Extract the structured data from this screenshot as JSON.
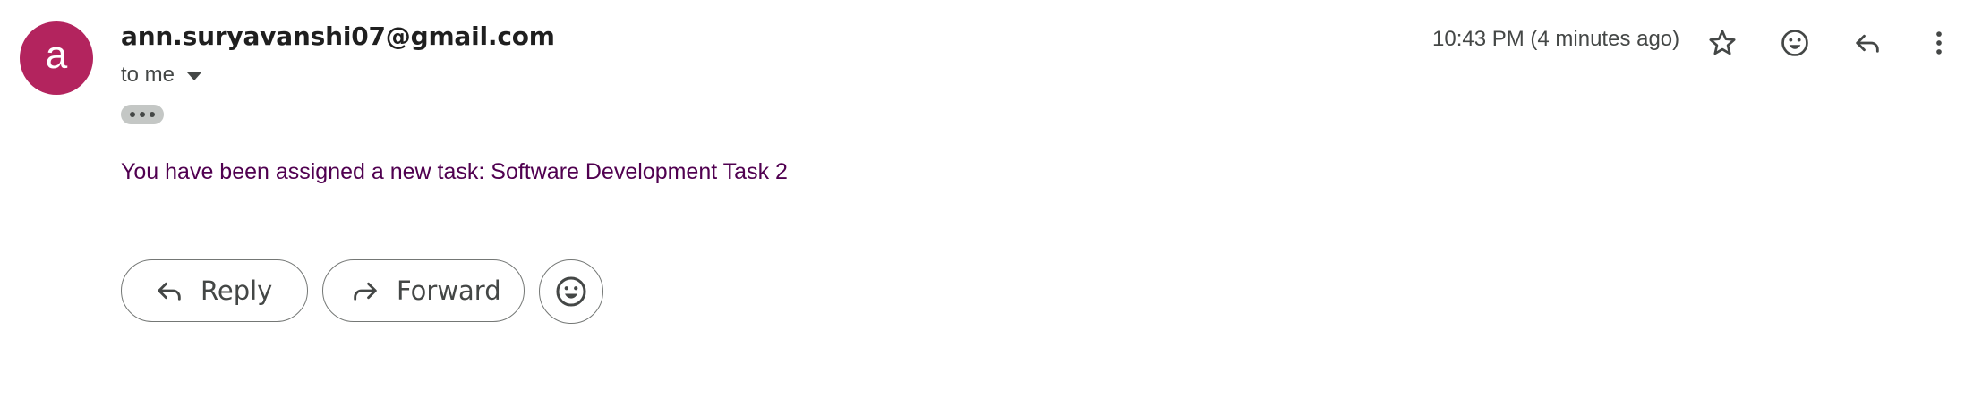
{
  "sender": {
    "avatar_letter": "a",
    "avatar_color": "#b3245e",
    "email": "ann.suryavanshi07@gmail.com",
    "recipient_label": "to me"
  },
  "header": {
    "timestamp": "10:43 PM (4 minutes ago)",
    "icons": [
      "star-icon",
      "emoji-icon",
      "reply-icon",
      "more-vert-icon"
    ]
  },
  "message": {
    "body": "You have been assigned a new task: Software Development Task 2",
    "body_color": "#500050"
  },
  "actions": {
    "reply_label": "Reply",
    "forward_label": "Forward"
  }
}
